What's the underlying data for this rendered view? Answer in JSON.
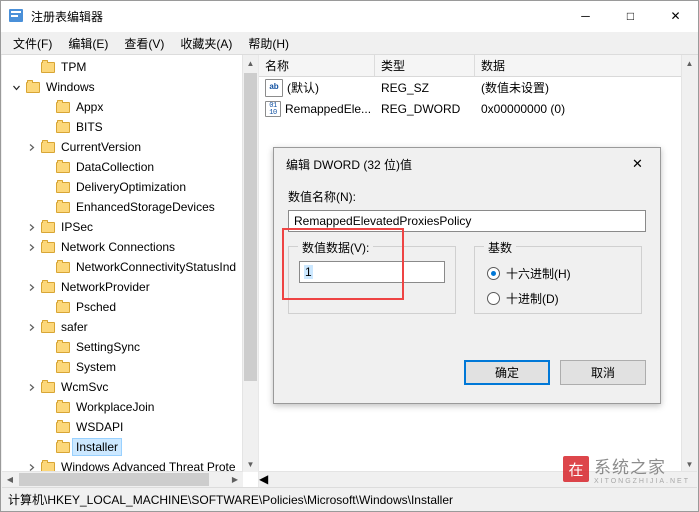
{
  "window": {
    "title": "注册表编辑器",
    "icon": "registry-icon",
    "minimize": "─",
    "maximize": "□",
    "close": "✕"
  },
  "menu": [
    {
      "label": "文件(F)"
    },
    {
      "label": "编辑(E)"
    },
    {
      "label": "查看(V)"
    },
    {
      "label": "收藏夹(A)"
    },
    {
      "label": "帮助(H)"
    }
  ],
  "tree": [
    {
      "label": "TPM",
      "indent": 1,
      "arrow": "none",
      "folder": true,
      "selected": false
    },
    {
      "label": "Windows",
      "indent": 0,
      "arrow": "expanded",
      "folder": true,
      "selected": false
    },
    {
      "label": "Appx",
      "indent": 2,
      "arrow": "none",
      "folder": true,
      "selected": false
    },
    {
      "label": "BITS",
      "indent": 2,
      "arrow": "none",
      "folder": true,
      "selected": false
    },
    {
      "label": "CurrentVersion",
      "indent": 1,
      "arrow": "collapsed",
      "folder": true,
      "selected": false
    },
    {
      "label": "DataCollection",
      "indent": 2,
      "arrow": "none",
      "folder": true,
      "selected": false
    },
    {
      "label": "DeliveryOptimization",
      "indent": 2,
      "arrow": "none",
      "folder": true,
      "selected": false
    },
    {
      "label": "EnhancedStorageDevices",
      "indent": 2,
      "arrow": "none",
      "folder": true,
      "selected": false
    },
    {
      "label": "IPSec",
      "indent": 1,
      "arrow": "collapsed",
      "folder": true,
      "selected": false
    },
    {
      "label": "Network Connections",
      "indent": 1,
      "arrow": "collapsed",
      "folder": true,
      "selected": false
    },
    {
      "label": "NetworkConnectivityStatusInd",
      "indent": 2,
      "arrow": "none",
      "folder": true,
      "selected": false
    },
    {
      "label": "NetworkProvider",
      "indent": 1,
      "arrow": "collapsed",
      "folder": true,
      "selected": false
    },
    {
      "label": "Psched",
      "indent": 2,
      "arrow": "none",
      "folder": true,
      "selected": false
    },
    {
      "label": "safer",
      "indent": 1,
      "arrow": "collapsed",
      "folder": true,
      "selected": false
    },
    {
      "label": "SettingSync",
      "indent": 2,
      "arrow": "none",
      "folder": true,
      "selected": false
    },
    {
      "label": "System",
      "indent": 2,
      "arrow": "none",
      "folder": true,
      "selected": false
    },
    {
      "label": "WcmSvc",
      "indent": 1,
      "arrow": "collapsed",
      "folder": true,
      "selected": false
    },
    {
      "label": "WorkplaceJoin",
      "indent": 2,
      "arrow": "none",
      "folder": true,
      "selected": false
    },
    {
      "label": "WSDAPI",
      "indent": 2,
      "arrow": "none",
      "folder": true,
      "selected": false
    },
    {
      "label": "Installer",
      "indent": 2,
      "arrow": "none",
      "folder": true,
      "selected": true
    },
    {
      "label": "Windows Advanced Threat Prote",
      "indent": 1,
      "arrow": "collapsed",
      "folder": true,
      "selected": false
    }
  ],
  "list": {
    "headers": {
      "name": "名称",
      "type": "类型",
      "data": "数据"
    },
    "rows": [
      {
        "icon": "string-value-icon",
        "name": "(默认)",
        "type": "REG_SZ",
        "data": "(数值未设置)"
      },
      {
        "icon": "dword-value-icon",
        "name": "RemappedEle...",
        "type": "REG_DWORD",
        "data": "0x00000000 (0)"
      }
    ]
  },
  "status": {
    "path": "计算机\\HKEY_LOCAL_MACHINE\\SOFTWARE\\Policies\\Microsoft\\Windows\\Installer"
  },
  "dialog": {
    "title": "编辑 DWORD (32 位)值",
    "close": "✕",
    "name_label": "数值名称(N):",
    "name_value": "RemappedElevatedProxiesPolicy",
    "data_label": "数值数据(V):",
    "data_value": "1",
    "base_legend": "基数",
    "base_options": [
      {
        "label": "十六进制(H)",
        "selected": true
      },
      {
        "label": "十进制(D)",
        "selected": false
      }
    ],
    "ok": "确定",
    "cancel": "取消"
  },
  "watermark": {
    "badge": "在",
    "main": "系统之家",
    "sub": "XITONGZHIJIA.NET"
  }
}
